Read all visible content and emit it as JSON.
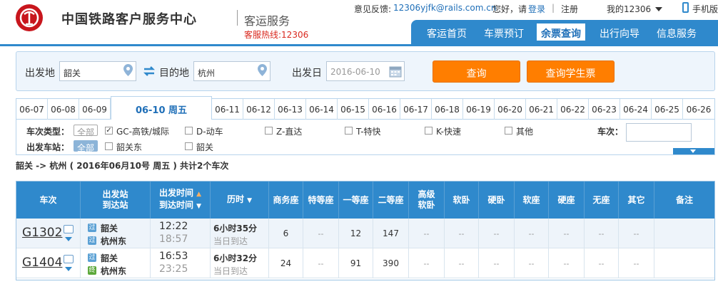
{
  "header": {
    "title": "中国铁路客户服务中心",
    "subtitle": "客运服务",
    "hotline": "客服热线:12306",
    "feedback_label": "意见反馈:",
    "feedback_email": "12306yjfk@rails.com.cn",
    "greeting": "您好，请",
    "login": "登录",
    "register": "注册",
    "my12306": "我的12306",
    "mobile": "手机版"
  },
  "nav": [
    "客运首页",
    "车票预订",
    "余票查询",
    "出行向导",
    "信息服务"
  ],
  "search": {
    "from_label": "出发地",
    "from": "韶关",
    "to_label": "目的地",
    "to": "杭州",
    "date_label": "出发日",
    "date": "2016-06-10",
    "query": "查询",
    "query_student": "查询学生票"
  },
  "dates": [
    "06-07",
    "06-08",
    "06-09",
    "06-10 周五",
    "06-11",
    "06-12",
    "06-13",
    "06-14",
    "06-15",
    "06-16",
    "06-17",
    "06-18",
    "06-19",
    "06-20",
    "06-21",
    "06-22",
    "06-23",
    "06-24",
    "06-25",
    "06-26"
  ],
  "filter": {
    "type_label": "车次类型：",
    "all": "全部",
    "types": [
      "GC-高铁/城际",
      "D-动车",
      "Z-直达",
      "T-特快",
      "K-快速",
      "其他"
    ],
    "station_label": "出发车站：",
    "stations": [
      "韶关东",
      "韶关"
    ],
    "train_no_label": "车次："
  },
  "summary": "韶关 -> 杭州 ( 2016年06月10号  周五 ) 共计2个车次",
  "table": {
    "headers": [
      "车次",
      "出发站|到达站",
      "出发时间|到达时间",
      "历时",
      "商务座",
      "特等座",
      "一等座",
      "二等座",
      "高级|软卧",
      "软卧",
      "硬卧",
      "软座",
      "硬座",
      "无座",
      "其它",
      "备注"
    ],
    "rows": [
      {
        "train": "G1302",
        "from": "韶关",
        "to": "杭州东",
        "to_badge": "过",
        "dep": "12:22",
        "arr": "18:57",
        "dur": "6小时35分",
        "day": "当日到达",
        "seats": [
          "6",
          "--",
          "12",
          "147",
          "--",
          "--",
          "--",
          "--",
          "--",
          "--",
          "--"
        ]
      },
      {
        "train": "G1404",
        "from": "韶关",
        "to": "杭州东",
        "to_badge": "终",
        "dep": "16:53",
        "arr": "23:25",
        "dur": "6小时32分",
        "day": "当日到达",
        "seats": [
          "24",
          "--",
          "91",
          "390",
          "--",
          "--",
          "--",
          "--",
          "--",
          "--",
          "--"
        ]
      }
    ]
  },
  "colors": {
    "accent": "#2f89cc",
    "orange": "#ff7e00",
    "red": "#c8161d"
  }
}
